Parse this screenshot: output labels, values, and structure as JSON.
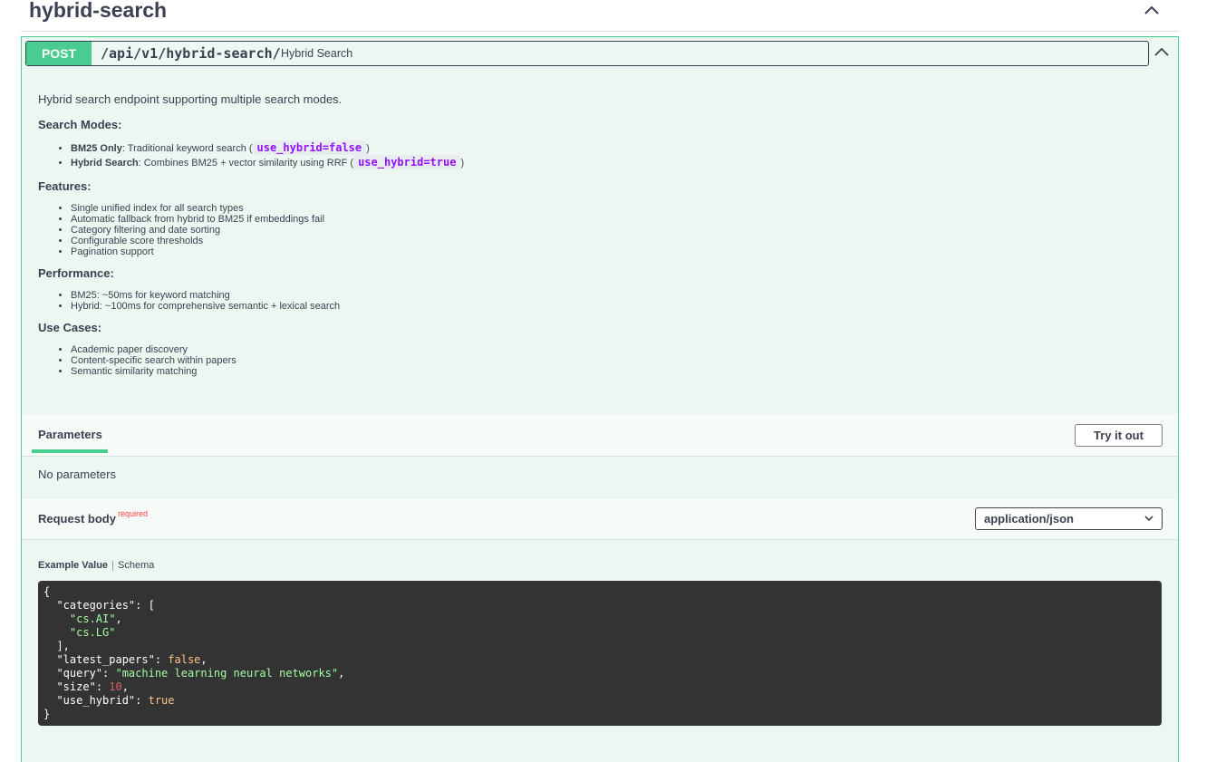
{
  "section": {
    "title": "hybrid-search"
  },
  "operation": {
    "method": "POST",
    "path": "/api/v1/hybrid-search/",
    "summary": "Hybrid Search"
  },
  "description": {
    "intro": "Hybrid search endpoint supporting multiple search modes.",
    "search_modes_heading": "Search Modes:",
    "search_modes": [
      {
        "label": "BM25 Only",
        "text": ": Traditional keyword search (",
        "code": "use_hybrid=false",
        "close": ")"
      },
      {
        "label": "Hybrid Search",
        "text": ": Combines BM25 + vector similarity using RRF (",
        "code": "use_hybrid=true",
        "close": ")"
      }
    ],
    "features_heading": "Features:",
    "features": [
      "Single unified index for all search types",
      "Automatic fallback from hybrid to BM25 if embeddings fail",
      "Category filtering and date sorting",
      "Configurable score thresholds",
      "Pagination support"
    ],
    "performance_heading": "Performance:",
    "performance": [
      "BM25: ~50ms for keyword matching",
      "Hybrid: ~100ms for comprehensive semantic + lexical search"
    ],
    "use_cases_heading": "Use Cases:",
    "use_cases": [
      "Academic paper discovery",
      "Content-specific search within papers",
      "Semantic similarity matching"
    ]
  },
  "parameters": {
    "tab_label": "Parameters",
    "try_button": "Try it out",
    "empty_text": "No parameters"
  },
  "request_body": {
    "title": "Request body",
    "required_label": "required",
    "content_type": "application/json",
    "example_tab": "Example Value",
    "schema_tab": "Schema"
  },
  "example": {
    "open": "{",
    "categories_key": "\"categories\"",
    "categories_open": ": [",
    "cat_1": "\"cs.AI\"",
    "cat_2": "\"cs.LG\"",
    "categories_close": "],",
    "latest_key": "\"latest_papers\"",
    "latest_val": "false",
    "query_key": "\"query\"",
    "query_val": "\"machine learning neural networks\"",
    "size_key": "\"size\"",
    "size_val": "10",
    "hybrid_key": "\"use_hybrid\"",
    "hybrid_val": "true",
    "close": "}"
  },
  "colors": {
    "post": "#49cc90",
    "post_bg": "#edf7f2",
    "required": "#f93e3e",
    "code_bg": "#333333",
    "inline_code": "#9012fe"
  },
  "icons": [
    "chevron-up-icon",
    "chevron-down-icon"
  ]
}
